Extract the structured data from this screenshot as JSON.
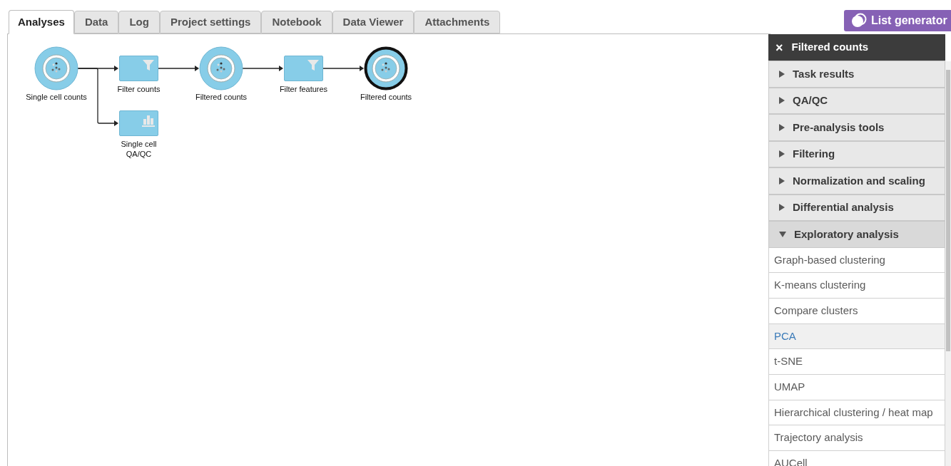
{
  "tabs": [
    {
      "label": "Analyses",
      "selected": true
    },
    {
      "label": "Data",
      "selected": false
    },
    {
      "label": "Log",
      "selected": false
    },
    {
      "label": "Project settings",
      "selected": false
    },
    {
      "label": "Notebook",
      "selected": false
    },
    {
      "label": "Data Viewer",
      "selected": false
    },
    {
      "label": "Attachments",
      "selected": false
    }
  ],
  "list_generator_button": {
    "label": "List generator"
  },
  "pipeline": {
    "kind": "data",
    "label": "Single cell counts",
    "selected": false,
    "children": [
      {
        "kind": "filter",
        "label": "Filter counts",
        "children": [
          {
            "kind": "data",
            "label": "Filtered counts",
            "selected": false,
            "children": [
              {
                "kind": "filter",
                "label": "Filter features",
                "children": [
                  {
                    "kind": "data",
                    "label": "Filtered counts",
                    "selected": true
                  }
                ]
              }
            ]
          }
        ]
      },
      {
        "kind": "chart",
        "label": "Single cell QA/QC"
      }
    ]
  },
  "task_menu": {
    "close": "×",
    "title": "Filtered counts",
    "sections": [
      {
        "label": "Task results",
        "expanded": false
      },
      {
        "label": "QA/QC",
        "expanded": false
      },
      {
        "label": "Pre-analysis tools",
        "expanded": false
      },
      {
        "label": "Filtering",
        "expanded": false
      },
      {
        "label": "Normalization and scaling",
        "expanded": false
      },
      {
        "label": "Differential analysis",
        "expanded": false
      },
      {
        "label": "Exploratory analysis",
        "expanded": true,
        "items": [
          {
            "label": "Graph-based clustering",
            "highlighted": false
          },
          {
            "label": "K-means clustering",
            "highlighted": false
          },
          {
            "label": "Compare clusters",
            "highlighted": false
          },
          {
            "label": "PCA",
            "highlighted": true
          },
          {
            "label": "t-SNE",
            "highlighted": false
          },
          {
            "label": "UMAP",
            "highlighted": false
          },
          {
            "label": "Hierarchical clustering / heat map",
            "highlighted": false
          },
          {
            "label": "Trajectory analysis",
            "highlighted": false
          },
          {
            "label": "AUCell",
            "highlighted": false
          }
        ]
      }
    ]
  }
}
